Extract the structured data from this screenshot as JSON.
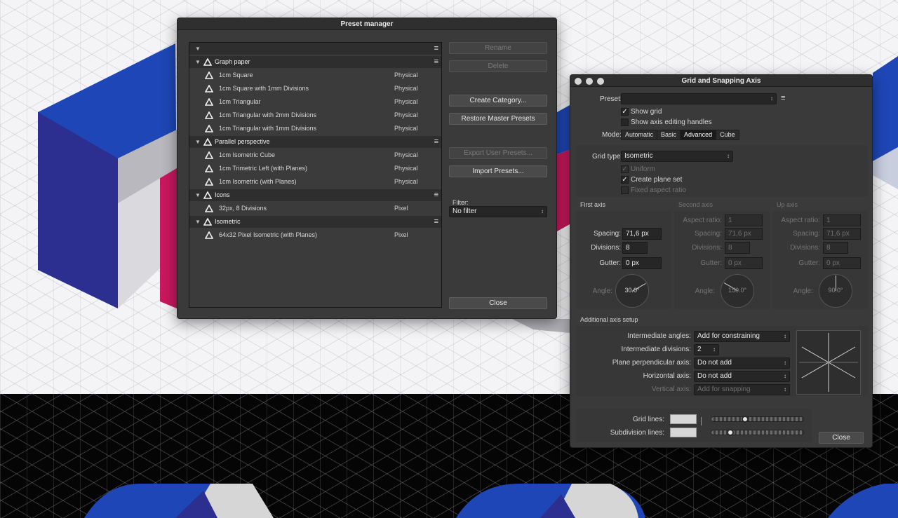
{
  "preset_manager": {
    "title": "Preset manager",
    "buttons": {
      "rename": "Rename",
      "delete": "Delete",
      "create_category": "Create Category...",
      "restore_master": "Restore Master Presets",
      "export_user": "Export User Presets...",
      "import": "Import Presets...",
      "close": "Close"
    },
    "filter": {
      "label": "Filter:",
      "value": "No filter"
    },
    "categories": [
      {
        "name": "Graph paper",
        "presets": [
          {
            "name": "1cm Square",
            "type": "Physical"
          },
          {
            "name": "1cm Square with 1mm Divisions",
            "type": "Physical"
          },
          {
            "name": "1cm Triangular",
            "type": "Physical"
          },
          {
            "name": "1cm Triangular with 2mm Divisions",
            "type": "Physical"
          },
          {
            "name": "1cm Triangular with 1mm Divisions",
            "type": "Physical"
          }
        ]
      },
      {
        "name": "Parallel perspective",
        "presets": [
          {
            "name": "1cm Isometric Cube",
            "type": "Physical"
          },
          {
            "name": "1cm Trimetric Left (with Planes)",
            "type": "Physical"
          },
          {
            "name": "1cm Isometric (with Planes)",
            "type": "Physical"
          }
        ]
      },
      {
        "name": "Icons",
        "presets": [
          {
            "name": "32px, 8 Divisions",
            "type": "Pixel"
          }
        ]
      },
      {
        "name": "Isometric",
        "presets": [
          {
            "name": "64x32 Pixel Isometric (with Planes)",
            "type": "Pixel"
          }
        ]
      }
    ]
  },
  "grid_dialog": {
    "title": "Grid and Snapping Axis",
    "preset_label": "Preset:",
    "preset_value": "",
    "show_grid": {
      "label": "Show grid",
      "checked": true
    },
    "show_axis_handles": {
      "label": "Show axis editing handles",
      "checked": false
    },
    "mode_label": "Mode:",
    "modes": [
      "Automatic",
      "Basic",
      "Advanced",
      "Cube"
    ],
    "active_mode": "Advanced",
    "grid_type_label": "Grid type:",
    "grid_type_value": "Isometric",
    "uniform": {
      "label": "Uniform",
      "checked": true
    },
    "create_plane_set": {
      "label": "Create plane set",
      "checked": true
    },
    "fixed_aspect": {
      "label": "Fixed aspect ratio",
      "checked": false
    },
    "axis_labels": {
      "aspect_ratio": "Aspect ratio:",
      "spacing": "Spacing:",
      "divisions": "Divisions:",
      "gutter": "Gutter:",
      "angle": "Angle:"
    },
    "axes": [
      {
        "title": "First axis",
        "aspect_ratio": "",
        "spacing": "71,6 px",
        "divisions": "8",
        "gutter": "0 px",
        "angle": "30.0°",
        "angle_deg": 30
      },
      {
        "title": "Second axis",
        "aspect_ratio": "1",
        "spacing": "71,6 px",
        "divisions": "8",
        "gutter": "0 px",
        "angle": "150.0°",
        "angle_deg": 150
      },
      {
        "title": "Up axis",
        "aspect_ratio": "1",
        "spacing": "71,6 px",
        "divisions": "8",
        "gutter": "0 px",
        "angle": "90.0°",
        "angle_deg": 90
      }
    ],
    "additional_title": "Additional axis setup",
    "intermediate_angles": {
      "label": "Intermediate angles:",
      "value": "Add for constraining"
    },
    "intermediate_divisions": {
      "label": "Intermediate divisions:",
      "value": "2"
    },
    "plane_perpendicular": {
      "label": "Plane perpendicular axis:",
      "value": "Do not add"
    },
    "horizontal_axis": {
      "label": "Horizontal axis:",
      "value": "Do not add"
    },
    "vertical_axis": {
      "label": "Vertical axis:",
      "value": "Add for snapping"
    },
    "grid_lines_label": "Grid lines:",
    "subdivision_lines_label": "Subdivision lines:",
    "grid_lines_opacity": 0.35,
    "subdivision_lines_opacity": 0.18,
    "close": "Close"
  }
}
